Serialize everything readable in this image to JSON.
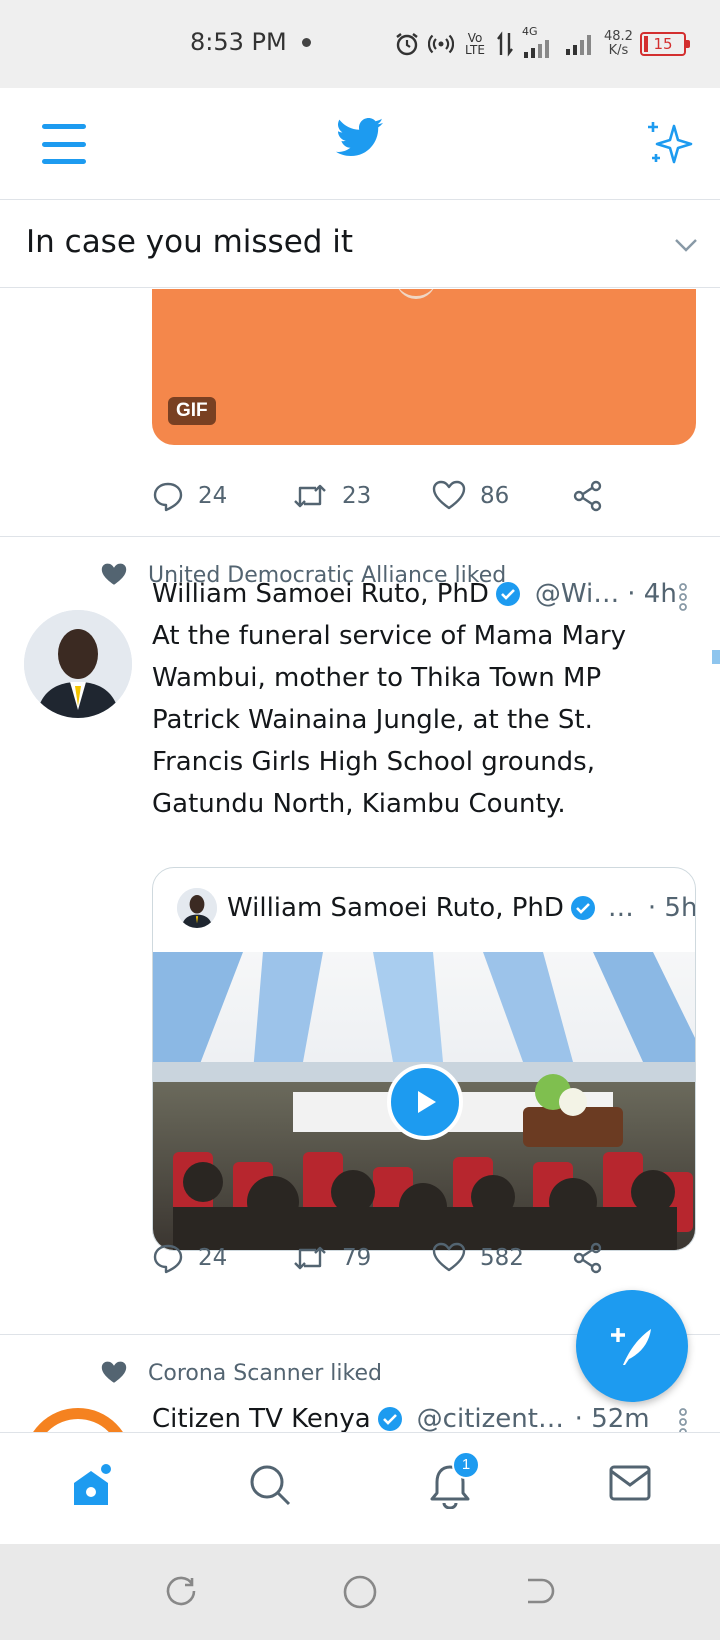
{
  "status_bar": {
    "time": "8:53 PM",
    "network": "4G",
    "volte": "Vo LTE",
    "speed_value": "48.2",
    "speed_unit": "K/s",
    "battery": "15"
  },
  "header": {
    "menu_icon": "hamburger-menu-icon",
    "logo_icon": "twitter-bird-icon",
    "sparkle_icon": "sparkle-icon",
    "accent_color": "#1d9bf0"
  },
  "section": {
    "title": "In case you missed it"
  },
  "tweets": [
    {
      "media_badge": "GIF",
      "stats": {
        "replies": "24",
        "retweets": "23",
        "likes": "86"
      }
    },
    {
      "social_context": "United Democratic Alliance liked",
      "author": "William Samoei Ruto, PhD",
      "handle": "@Wi…",
      "time": "· 4h",
      "text": "At the funeral service of Mama Mary Wambui, mother to Thika Town MP Patrick Wainaina Jungle, at the St. Francis Girls High School grounds, Gatundu North, Kiambu County.",
      "quote": {
        "author": "William Samoei Ruto, PhD",
        "handle": "…",
        "time": "· 5h"
      },
      "stats": {
        "replies": "24",
        "retweets": "79",
        "likes": "582"
      }
    },
    {
      "social_context": "Corona Scanner liked",
      "author": "Citizen TV Kenya",
      "handle": "@citizentv…",
      "time": "· 52m"
    }
  ],
  "bottom_nav": {
    "items": [
      "home-icon",
      "search-icon",
      "notifications-icon",
      "messages-icon"
    ],
    "notification_count": "1"
  }
}
